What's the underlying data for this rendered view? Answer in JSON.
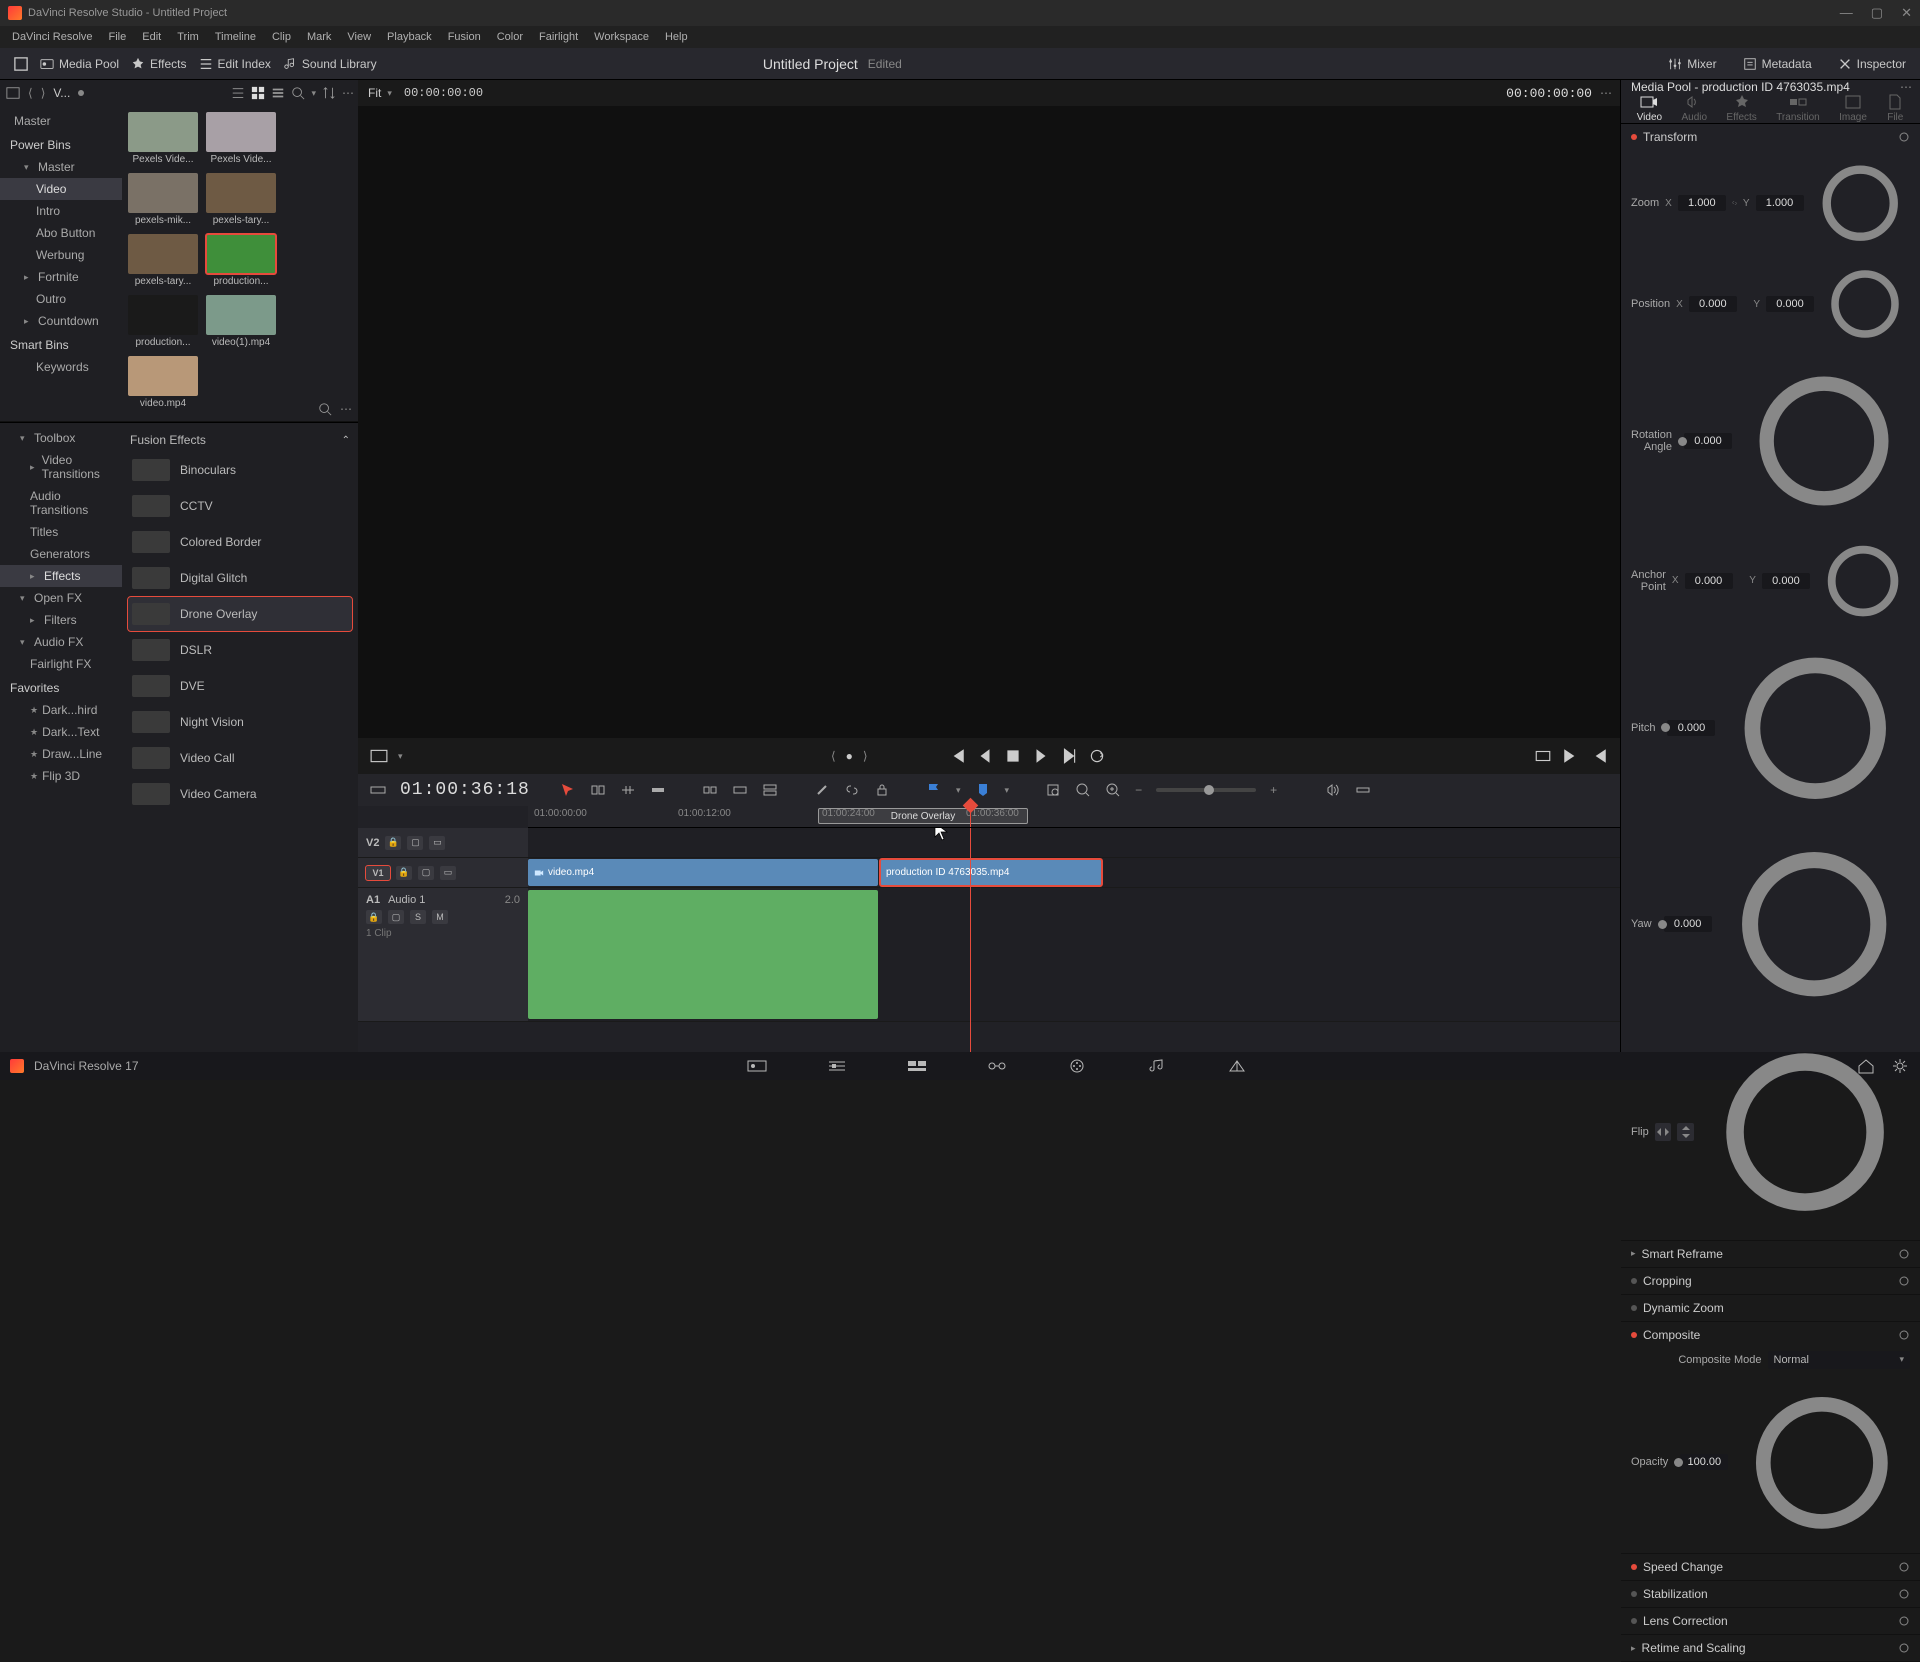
{
  "titlebar": {
    "text": "DaVinci Resolve Studio - Untitled Project"
  },
  "menu": [
    "DaVinci Resolve",
    "File",
    "Edit",
    "Trim",
    "Timeline",
    "Clip",
    "Mark",
    "View",
    "Playback",
    "Fusion",
    "Color",
    "Fairlight",
    "Workspace",
    "Help"
  ],
  "toolbar": {
    "mediapool": "Media Pool",
    "effects": "Effects",
    "editindex": "Edit Index",
    "soundlib": "Sound Library",
    "mixer": "Mixer",
    "metadata": "Metadata",
    "inspector": "Inspector",
    "project_title": "Untitled Project",
    "project_status": "Edited"
  },
  "pool": {
    "v_label": "V...",
    "master": "Master",
    "powerbins": "Power Bins",
    "smartbins": "Smart Bins",
    "keywords": "Keywords",
    "bins": [
      "Master",
      "Video",
      "Intro",
      "Abo Button",
      "Werbung",
      "Fortnite",
      "Outro",
      "Countdown"
    ],
    "clips": [
      {
        "name": "Pexels Vide...",
        "bg": "#8b9a88"
      },
      {
        "name": "Pexels Vide...",
        "bg": "#a8a0a6"
      },
      {
        "name": "pexels-mik...",
        "bg": "#7a7166"
      },
      {
        "name": "pexels-tary...",
        "bg": "#6e5a44"
      },
      {
        "name": "pexels-tary...",
        "bg": "#6e5a44"
      },
      {
        "name": "production...",
        "bg": "#3f8f3a",
        "sel": true
      },
      {
        "name": "production...",
        "bg": "#1a1a1a"
      },
      {
        "name": "video(1).mp4",
        "bg": "#7c9a8a"
      },
      {
        "name": "video.mp4",
        "bg": "#b89878"
      }
    ]
  },
  "fx": {
    "header": "Fusion Effects",
    "tree": [
      {
        "label": "Toolbox",
        "chev": "▾"
      },
      {
        "label": "Video Transitions",
        "indent": true,
        "chev": "▸"
      },
      {
        "label": "Audio Transitions",
        "indent": true
      },
      {
        "label": "Titles",
        "indent": true
      },
      {
        "label": "Generators",
        "indent": true
      },
      {
        "label": "Effects",
        "indent": true,
        "sel": true,
        "chev": "▸"
      },
      {
        "label": "Open FX",
        "chev": "▾"
      },
      {
        "label": "Filters",
        "indent": true,
        "chev": "▸"
      },
      {
        "label": "Audio FX",
        "chev": "▾"
      },
      {
        "label": "Fairlight FX",
        "indent": true
      }
    ],
    "favorites": "Favorites",
    "favs": [
      "Dark...hird",
      "Dark...Text",
      "Draw...Line",
      "Flip 3D"
    ],
    "items": [
      {
        "name": "Binoculars"
      },
      {
        "name": "CCTV"
      },
      {
        "name": "Colored Border"
      },
      {
        "name": "Digital Glitch"
      },
      {
        "name": "Drone Overlay",
        "sel": true
      },
      {
        "name": "DSLR"
      },
      {
        "name": "DVE"
      },
      {
        "name": "Night Vision"
      },
      {
        "name": "Video Call"
      },
      {
        "name": "Video Camera"
      }
    ]
  },
  "viewer": {
    "fit": "Fit",
    "tc_left": "00:00:00:00",
    "tc_right": "00:00:00:00"
  },
  "timeline": {
    "current": "01:00:36:18",
    "ticks": [
      "01:00:00:00",
      "01:00:12:00",
      "01:00:24:00",
      "01:00:36:00"
    ],
    "v2": "V2",
    "v1": "V1",
    "a1": "A1",
    "a1name": "Audio 1",
    "a1ch": "2.0",
    "a1clips": "1 Clip",
    "clip1": "video.mp4",
    "clip2": "production ID 4763035.mp4",
    "ghost": "Drone Overlay"
  },
  "inspector": {
    "title": "Media Pool - production ID 4763035.mp4",
    "tabs": [
      "Video",
      "Audio",
      "Effects",
      "Transition",
      "Image",
      "File"
    ],
    "sections": {
      "transform": "Transform",
      "zoom": "Zoom",
      "position": "Position",
      "rotation": "Rotation Angle",
      "anchor": "Anchor Point",
      "pitch": "Pitch",
      "yaw": "Yaw",
      "flip": "Flip",
      "smartreframe": "Smart Reframe",
      "cropping": "Cropping",
      "dynamiczoom": "Dynamic Zoom",
      "composite": "Composite",
      "compositemode": "Composite Mode",
      "normal": "Normal",
      "opacity": "Opacity",
      "speedchange": "Speed Change",
      "stabilization": "Stabilization",
      "lenscorrection": "Lens Correction",
      "retime": "Retime and Scaling"
    },
    "vals": {
      "zoomx": "1.000",
      "zoomy": "1.000",
      "posx": "0.000",
      "posy": "0.000",
      "rot": "0.000",
      "anchx": "0.000",
      "anchy": "0.000",
      "pitch": "0.000",
      "yaw": "0.000",
      "opacity": "100.00"
    }
  },
  "bottom": {
    "version": "DaVinci Resolve 17"
  }
}
